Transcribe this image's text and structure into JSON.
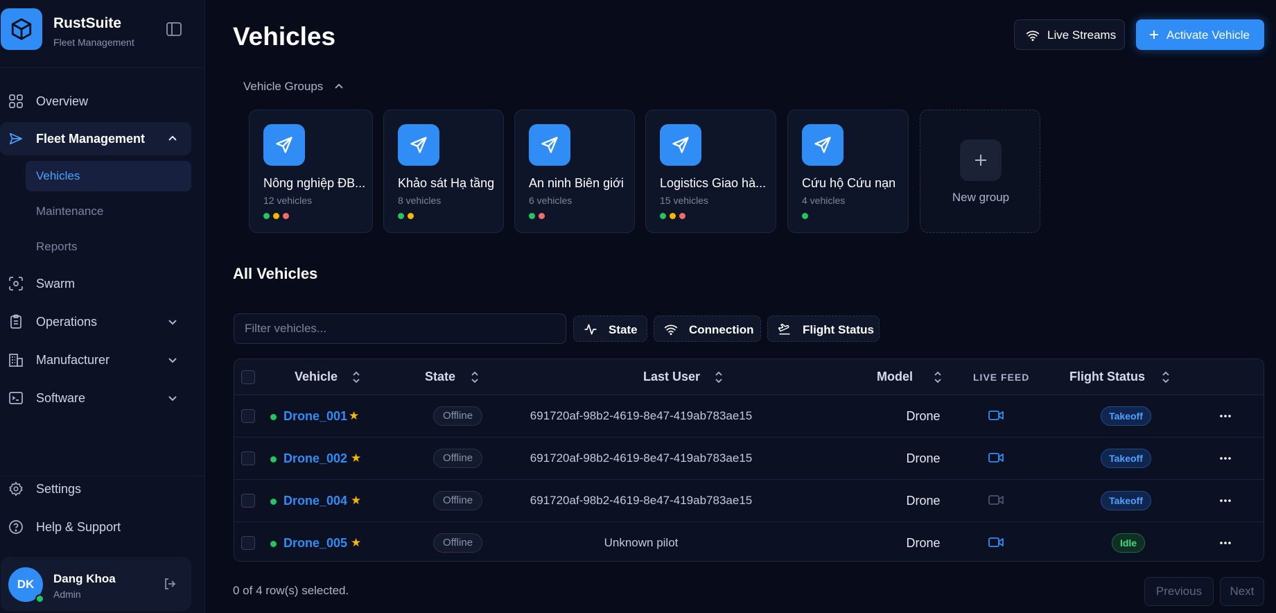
{
  "brand": {
    "title": "RustSuite",
    "subtitle": "Fleet Management"
  },
  "sidebar": {
    "nav": [
      {
        "label": "Overview",
        "icon": "grid-icon"
      },
      {
        "label": "Fleet Management",
        "icon": "send-icon",
        "expanded": true
      },
      {
        "label": "Swarm",
        "icon": "scan-icon"
      },
      {
        "label": "Operations",
        "icon": "clipboard-icon"
      },
      {
        "label": "Manufacturer",
        "icon": "building-icon"
      },
      {
        "label": "Software",
        "icon": "terminal-icon"
      }
    ],
    "sub": [
      {
        "label": "Vehicles",
        "active": true
      },
      {
        "label": "Maintenance"
      },
      {
        "label": "Reports"
      }
    ],
    "bottom": [
      {
        "label": "Settings",
        "icon": "gear-icon"
      },
      {
        "label": "Help & Support",
        "icon": "help-icon"
      }
    ],
    "user": {
      "initials": "DK",
      "name": "Dang Khoa",
      "role": "Admin"
    }
  },
  "header": {
    "title": "Vehicles",
    "live_streams": "Live Streams",
    "activate": "Activate Vehicle"
  },
  "groups": {
    "toggle_label": "Vehicle Groups",
    "items": [
      {
        "name": "Nông nghiệp ĐB...",
        "count": "12 vehicles",
        "dots": [
          "#22c55e",
          "#f5b800",
          "#f26b6b"
        ]
      },
      {
        "name": "Khảo sát Hạ tầng",
        "count": "8 vehicles",
        "dots": [
          "#22c55e",
          "#f5b800"
        ]
      },
      {
        "name": "An ninh Biên giới",
        "count": "6 vehicles",
        "dots": [
          "#22c55e",
          "#f26b6b"
        ]
      },
      {
        "name": "Logistics Giao hà...",
        "count": "15 vehicles",
        "dots": [
          "#22c55e",
          "#f5b800",
          "#f26b6b"
        ]
      },
      {
        "name": "Cứu hộ Cứu nạn",
        "count": "4 vehicles",
        "dots": [
          "#22c55e"
        ]
      }
    ],
    "new_group": "New group"
  },
  "all_vehicles": {
    "title": "All Vehicles",
    "filter_placeholder": "Filter vehicles...",
    "chips": [
      "State",
      "Connection",
      "Flight Status"
    ]
  },
  "table": {
    "headers": {
      "vehicle": "Vehicle",
      "state": "State",
      "last_user": "Last User",
      "model": "Model",
      "live_feed": "LIVE FEED",
      "flight_status": "Flight Status"
    },
    "rows": [
      {
        "vehicle": "Drone_001",
        "state": "Offline",
        "last_user": "691720af-98b2-4619-8e47-419ab783ae15",
        "model": "Drone",
        "feed_active": true,
        "flight_status": "Takeoff"
      },
      {
        "vehicle": "Drone_002",
        "state": "Offline",
        "last_user": "691720af-98b2-4619-8e47-419ab783ae15",
        "model": "Drone",
        "feed_active": true,
        "flight_status": "Takeoff"
      },
      {
        "vehicle": "Drone_004",
        "state": "Offline",
        "last_user": "691720af-98b2-4619-8e47-419ab783ae15",
        "model": "Drone",
        "feed_active": false,
        "flight_status": "Takeoff"
      },
      {
        "vehicle": "Drone_005",
        "state": "Offline",
        "last_user": "Unknown pilot",
        "model": "Drone",
        "feed_active": true,
        "flight_status": "Idle"
      }
    ]
  },
  "footer": {
    "selected": "0 of 4 row(s) selected.",
    "previous": "Previous",
    "next": "Next"
  },
  "colors": {
    "accent": "#2f8df5",
    "background": "#070b1a",
    "sidebar": "#0c1124",
    "online": "#22c55e"
  }
}
